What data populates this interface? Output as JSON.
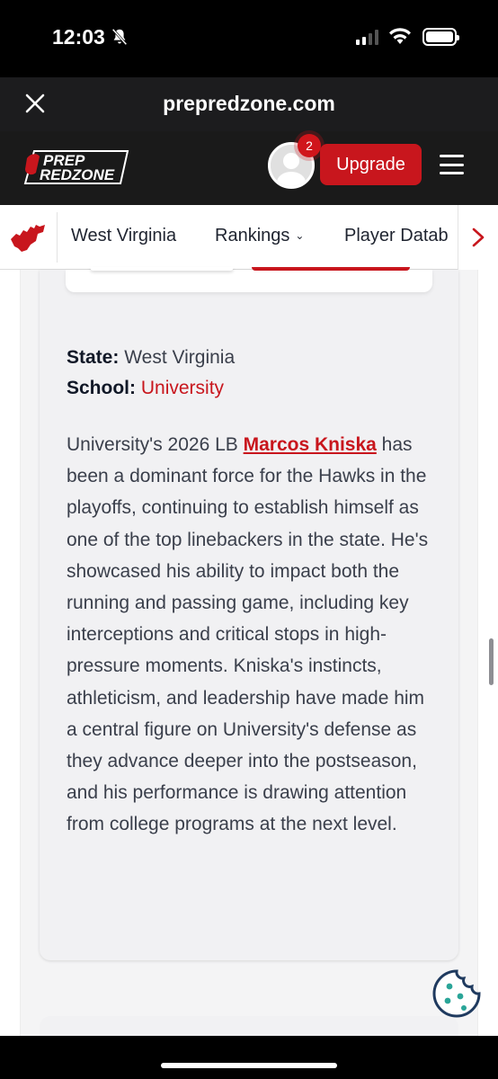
{
  "status_bar": {
    "time": "12:03"
  },
  "browser": {
    "url": "prepredzone.com"
  },
  "site": {
    "logo_text_line1": "PREP",
    "logo_text_line2": "REDZONE",
    "notification_count": "2",
    "upgrade_label": "Upgrade"
  },
  "nav": {
    "items": [
      {
        "label": "West Virginia"
      },
      {
        "label": "Rankings"
      },
      {
        "label": "Player Datab"
      }
    ]
  },
  "article": {
    "state_label": "State:",
    "state_value": "West Virginia",
    "school_label": "School:",
    "school_value": "University",
    "body_prefix": "University's 2026 LB ",
    "player_link": "Marcos Kniska",
    "body_rest": " has been a dominant force for the Hawks in the playoffs, continuing to establish himself as one of the top linebackers in the state. He's showcased his ability to impact both the running and passing game, including key interceptions and critical stops in high-pressure moments. Kniska's instincts, athleticism, and leadership have made him a central figure on University's defense as they advance deeper into the postseason, and his performance is drawing attention from college programs at the next level."
  },
  "colors": {
    "brand_red": "#c8161d",
    "header_dark": "#1a1a1a",
    "card_bg": "#f1f1f3"
  },
  "icons": [
    "bell-off-icon",
    "signal-icon",
    "wifi-icon",
    "battery-icon",
    "close-icon",
    "avatar-icon",
    "menu-icon",
    "west-virginia-icon",
    "chevron-down-icon",
    "chevron-right-icon",
    "cookie-icon"
  ]
}
